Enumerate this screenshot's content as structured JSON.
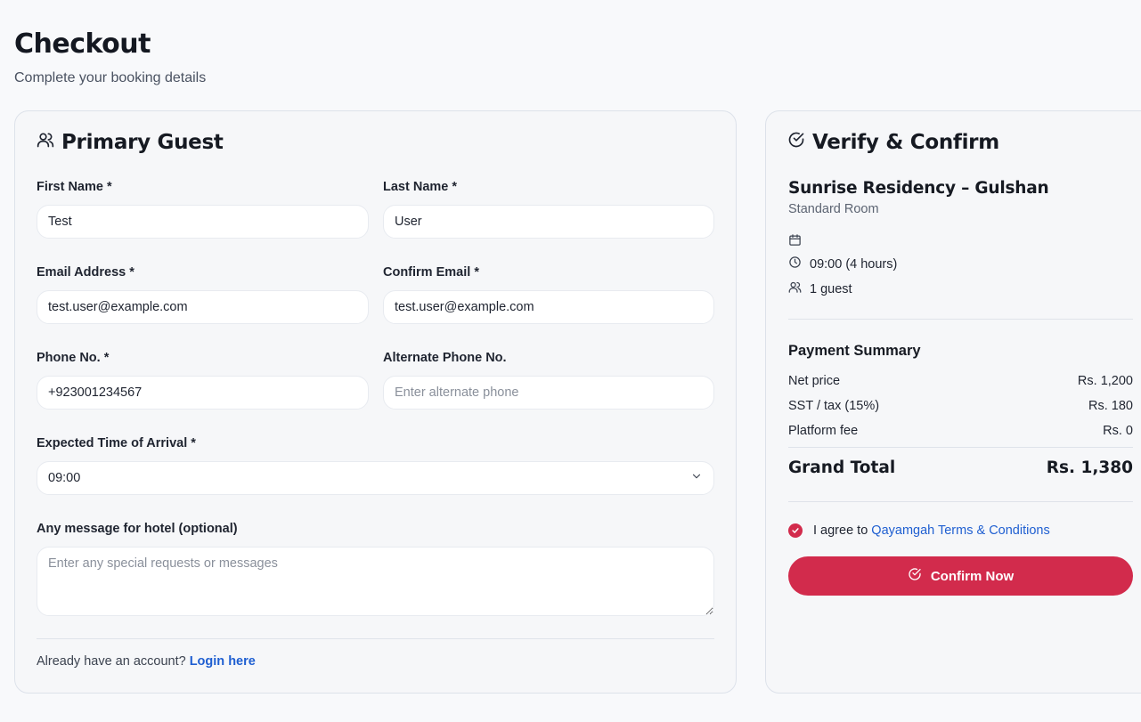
{
  "header": {
    "title": "Checkout",
    "subtitle": "Complete your booking details"
  },
  "guest": {
    "heading": "Primary Guest",
    "icon": "users-icon",
    "first_name": {
      "label": "First Name *",
      "value": "Test"
    },
    "last_name": {
      "label": "Last Name *",
      "value": "User"
    },
    "email": {
      "label": "Email Address *",
      "value": "test.user@example.com"
    },
    "confirm_email": {
      "label": "Confirm Email *",
      "value": "test.user@example.com"
    },
    "phone": {
      "label": "Phone No. *",
      "value": "+923001234567"
    },
    "alt_phone": {
      "label": "Alternate Phone No.",
      "value": "",
      "placeholder": "Enter alternate phone"
    },
    "arrival": {
      "label": "Expected Time of Arrival *",
      "value": "09:00"
    },
    "message": {
      "label": "Any message for hotel (optional)",
      "value": "",
      "placeholder": "Enter any special requests or messages"
    },
    "login_prompt": "Already have an account?",
    "login_link": "Login here"
  },
  "confirm": {
    "heading": "Verify & Confirm",
    "icon": "check-circle-icon",
    "hotel_name": "Sunrise Residency – Gulshan",
    "room_type": "Standard Room",
    "date_text": "",
    "time_text": "09:00 (4 hours)",
    "guests_text": "1 guest",
    "summary_title": "Payment Summary",
    "rows": [
      {
        "label": "Net price",
        "value": "Rs. 1,200"
      },
      {
        "label": "SST / tax (15%)",
        "value": "Rs. 180"
      },
      {
        "label": "Platform fee",
        "value": "Rs. 0"
      }
    ],
    "grand_total_label": "Grand Total",
    "grand_total_value": "Rs. 1,380",
    "agree_text": "I agree to",
    "terms_link": "Qayamgah Terms & Conditions",
    "agree_checked": true,
    "button_label": "Confirm Now"
  },
  "colors": {
    "accent": "#d22b4c",
    "link": "#1f5fd1",
    "background": "#f8f9fb"
  }
}
